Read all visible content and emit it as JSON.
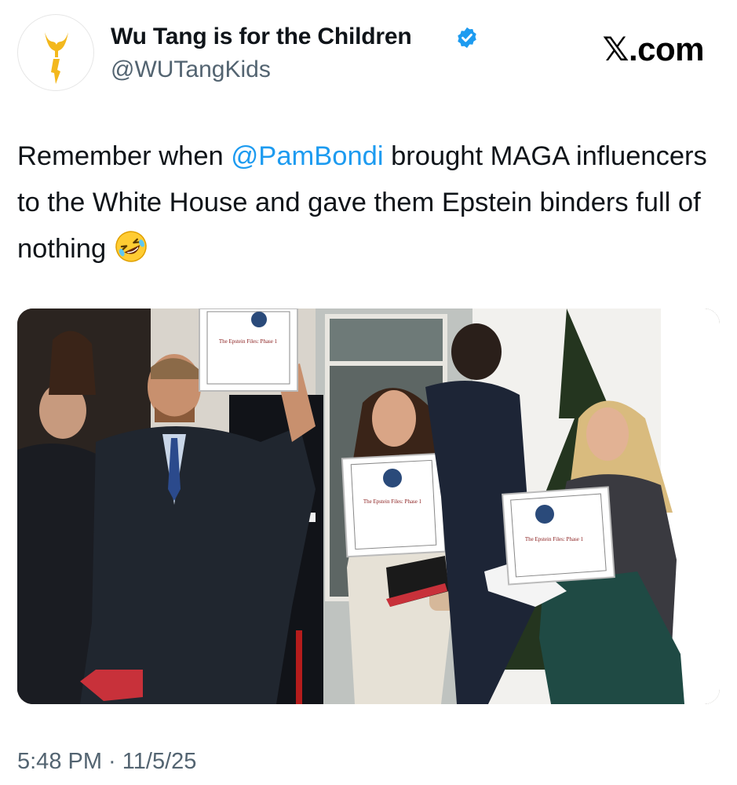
{
  "author": {
    "display_name": "Wu Tang is for the Children",
    "handle": "@WUTangKids",
    "verified_icon": "verified-badge-icon",
    "avatar_icon": "wu-tang-logo-icon"
  },
  "brand": {
    "prefix": "𝕏",
    "suffix": ".com"
  },
  "tweet": {
    "text_before": "Remember when ",
    "mention": "@PamBondi",
    "text_after": " brought MAGA influencers to the White House and gave them Epstein binders full of nothing ",
    "emoji_icon": "rolling-on-floor-laughing-emoji"
  },
  "media": {
    "binder_label": "The Epstein Files: Phase 1",
    "image_description_icon": "photo-of-three-people-holding-white-binders"
  },
  "timestamp": {
    "time": "5:48 PM",
    "separator": " · ",
    "date": "11/5/25"
  },
  "colors": {
    "accent": "#1d9bf0",
    "text": "#0f1419",
    "secondary": "#536471",
    "background": "#ffffff"
  }
}
